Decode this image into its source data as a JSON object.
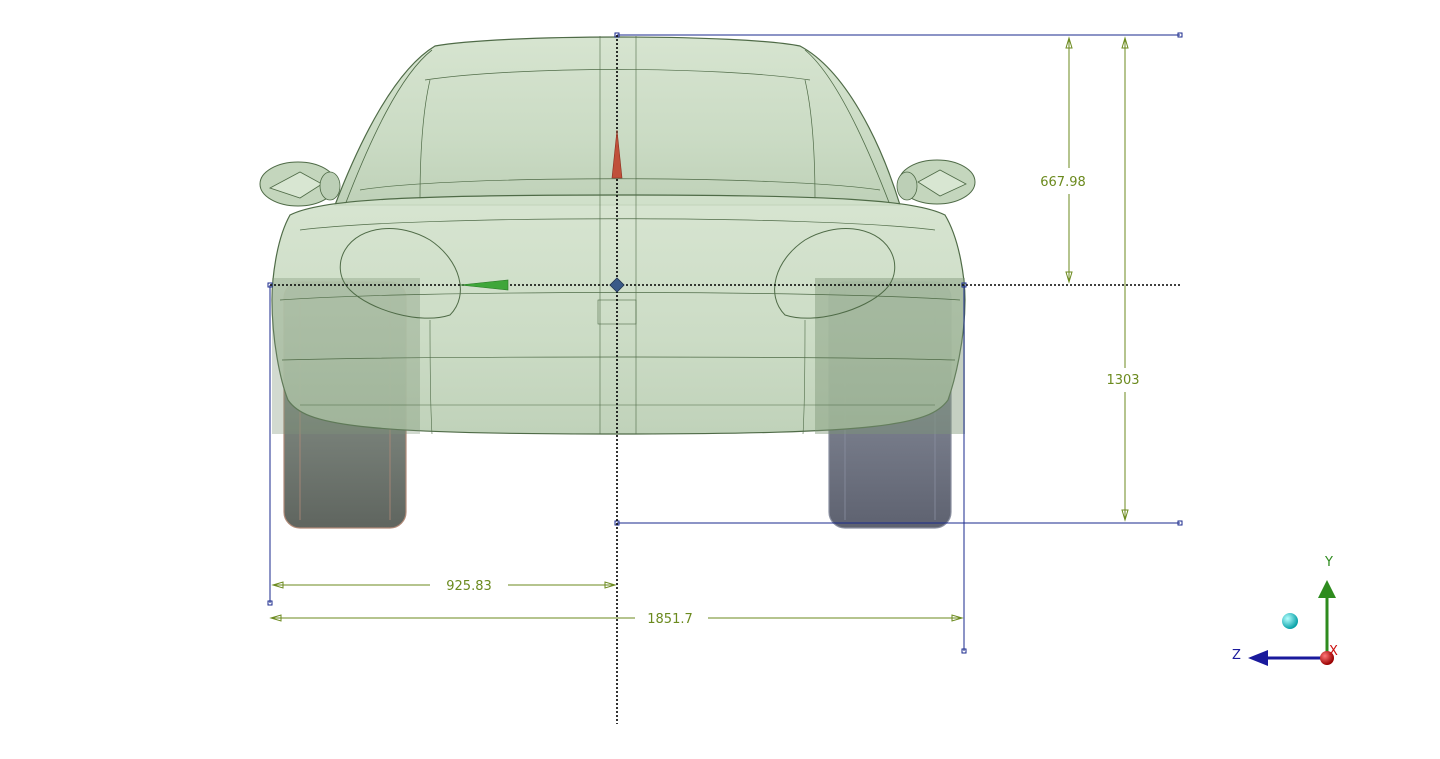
{
  "dimensions": {
    "roof_to_center": "667.98",
    "total_height": "1303",
    "half_width": "925.83",
    "full_width": "1851.7"
  },
  "triad": {
    "y_label": "Y",
    "z_label": "Z",
    "x_label": "X"
  },
  "colors": {
    "body_fill": "#c9dbc2",
    "body_edge": "#4f6b47",
    "dimension": "#6b8a1e",
    "reference_line": "#1a2a8c",
    "axis_y": "#2e8b1e",
    "axis_z": "#1a1a9c",
    "axis_x": "#cc1111",
    "origin_marker": "#3a5a88"
  }
}
